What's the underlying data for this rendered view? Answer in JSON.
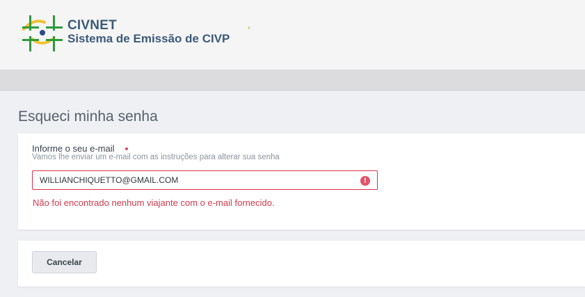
{
  "header": {
    "brand_name": "CIVNET",
    "brand_subtitle": "Sistema de Emissão de CIVP",
    "logo_icon": "civnet-logo-icon"
  },
  "page": {
    "title": "Esqueci minha senha"
  },
  "form": {
    "email_label": "Informe o seu e-mail",
    "email_hint": "Vamos lhe enviar um e-mail com as instruções para alterar sua senha",
    "email_value": "WILLIANCHIQUETTO@GMAIL.COM",
    "error_icon": "!",
    "error_message": "Não foi encontrado nenhum viajante com o e-mail fornecido."
  },
  "actions": {
    "cancel_label": "Cancelar"
  },
  "colors": {
    "brand": "#3b5a7a",
    "error": "#d7334a",
    "logo_green": "#2f9a3c",
    "logo_yellow": "#f2c230",
    "logo_blue": "#2b4a8b"
  }
}
